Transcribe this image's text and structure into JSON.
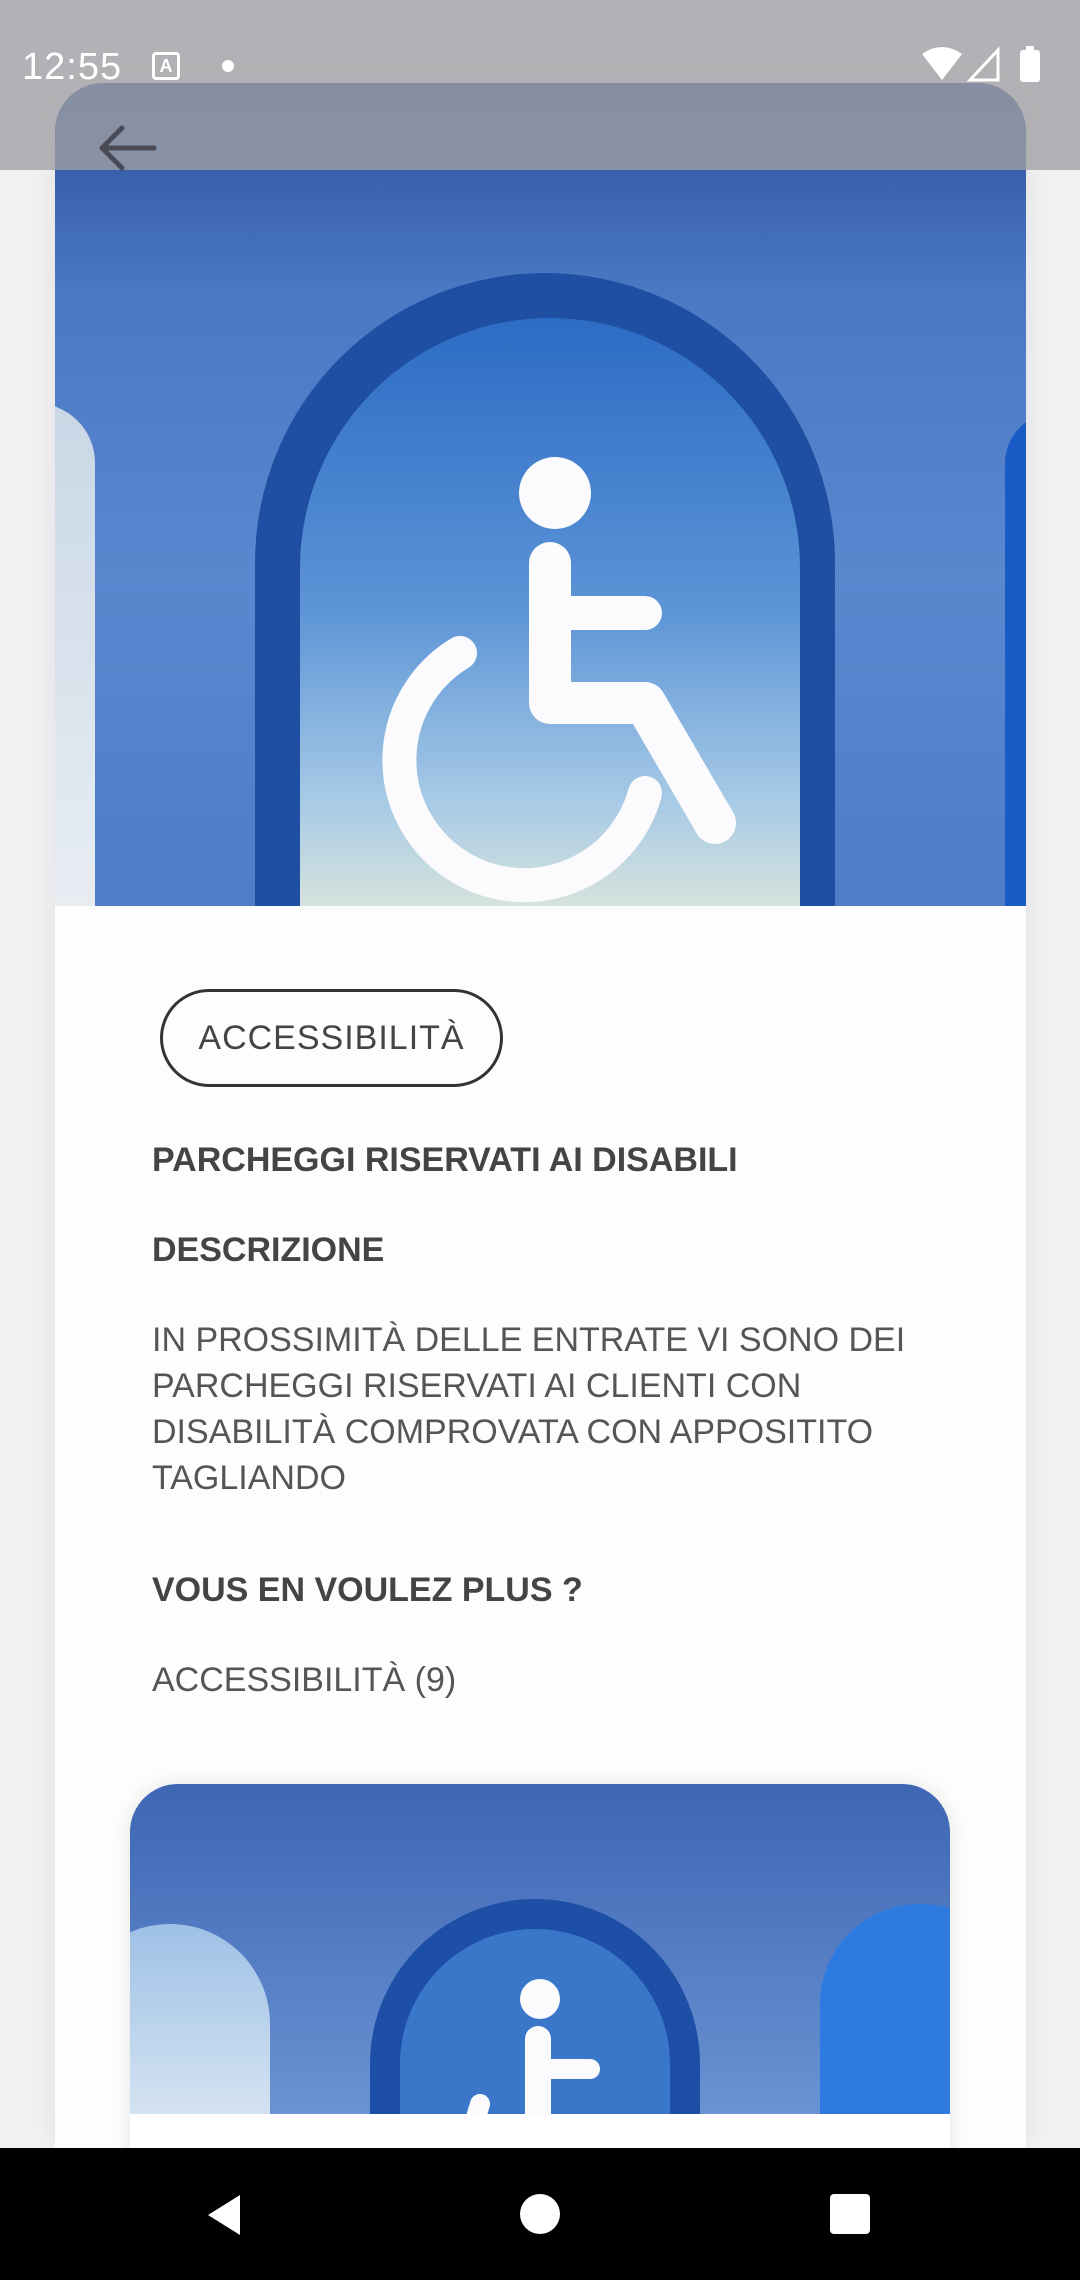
{
  "status_bar": {
    "time": "12:55",
    "icons": [
      "a-notification-icon",
      "dot-icon",
      "wifi-icon",
      "signal-icon",
      "battery-icon"
    ]
  },
  "toolbar": {
    "back_icon": "arrow-left-icon"
  },
  "detail": {
    "category_chip": "ACCESSIBILITÀ",
    "title": "PARCHEGGI RISERVATI AI DISABILI",
    "description_heading": "DESCRIZIONE",
    "description_text": "IN PROSSIMITÀ DELLE ENTRATE VI SONO DEI PARCHEGGI RISERVATI AI CLIENTI CON DISABILITÀ COMPROVATA CON APPOSITITO TAGLIANDO",
    "more_heading": "VOUS EN VOULEZ PLUS ?",
    "more_link": "ACCESSIBILITÀ (9)"
  },
  "colors": {
    "accent_dark": "#1f4fa2",
    "sky": "#5b87cf",
    "text": "#444444"
  },
  "nav_bar": {
    "buttons": [
      "back-triangle-icon",
      "home-circle-icon",
      "recents-square-icon"
    ]
  }
}
